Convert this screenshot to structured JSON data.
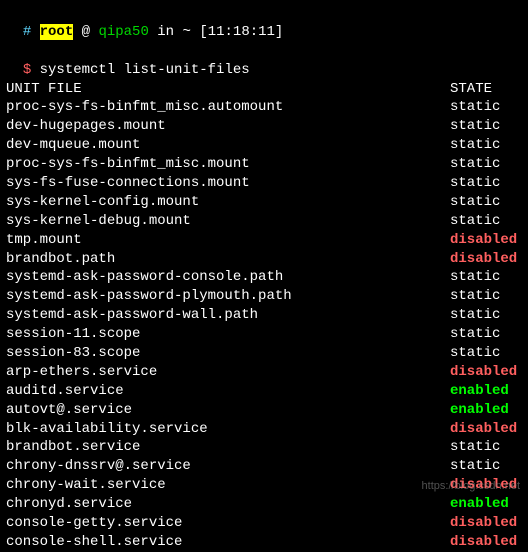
{
  "prompt": {
    "hash": "#",
    "user": "root",
    "at": "@",
    "host": "qipa50",
    "in": "in",
    "path": "~",
    "time": "[11:18:11]",
    "dollar": "$",
    "command": "systemctl list-unit-files"
  },
  "header": {
    "unit": "UNIT FILE",
    "state": "STATE"
  },
  "rows": [
    {
      "unit": "proc-sys-fs-binfmt_misc.automount",
      "state": "static"
    },
    {
      "unit": "dev-hugepages.mount",
      "state": "static"
    },
    {
      "unit": "dev-mqueue.mount",
      "state": "static"
    },
    {
      "unit": "proc-sys-fs-binfmt_misc.mount",
      "state": "static"
    },
    {
      "unit": "sys-fs-fuse-connections.mount",
      "state": "static"
    },
    {
      "unit": "sys-kernel-config.mount",
      "state": "static"
    },
    {
      "unit": "sys-kernel-debug.mount",
      "state": "static"
    },
    {
      "unit": "tmp.mount",
      "state": "disabled"
    },
    {
      "unit": "brandbot.path",
      "state": "disabled"
    },
    {
      "unit": "systemd-ask-password-console.path",
      "state": "static"
    },
    {
      "unit": "systemd-ask-password-plymouth.path",
      "state": "static"
    },
    {
      "unit": "systemd-ask-password-wall.path",
      "state": "static"
    },
    {
      "unit": "session-11.scope",
      "state": "static"
    },
    {
      "unit": "session-83.scope",
      "state": "static"
    },
    {
      "unit": "arp-ethers.service",
      "state": "disabled"
    },
    {
      "unit": "auditd.service",
      "state": "enabled"
    },
    {
      "unit": "autovt@.service",
      "state": "enabled"
    },
    {
      "unit": "blk-availability.service",
      "state": "disabled"
    },
    {
      "unit": "brandbot.service",
      "state": "static"
    },
    {
      "unit": "chrony-dnssrv@.service",
      "state": "static"
    },
    {
      "unit": "chrony-wait.service",
      "state": "disabled"
    },
    {
      "unit": "chronyd.service",
      "state": "enabled"
    },
    {
      "unit": "console-getty.service",
      "state": "disabled"
    },
    {
      "unit": "console-shell.service",
      "state": "disabled"
    }
  ],
  "watermark": "https://blog.csdn.net"
}
